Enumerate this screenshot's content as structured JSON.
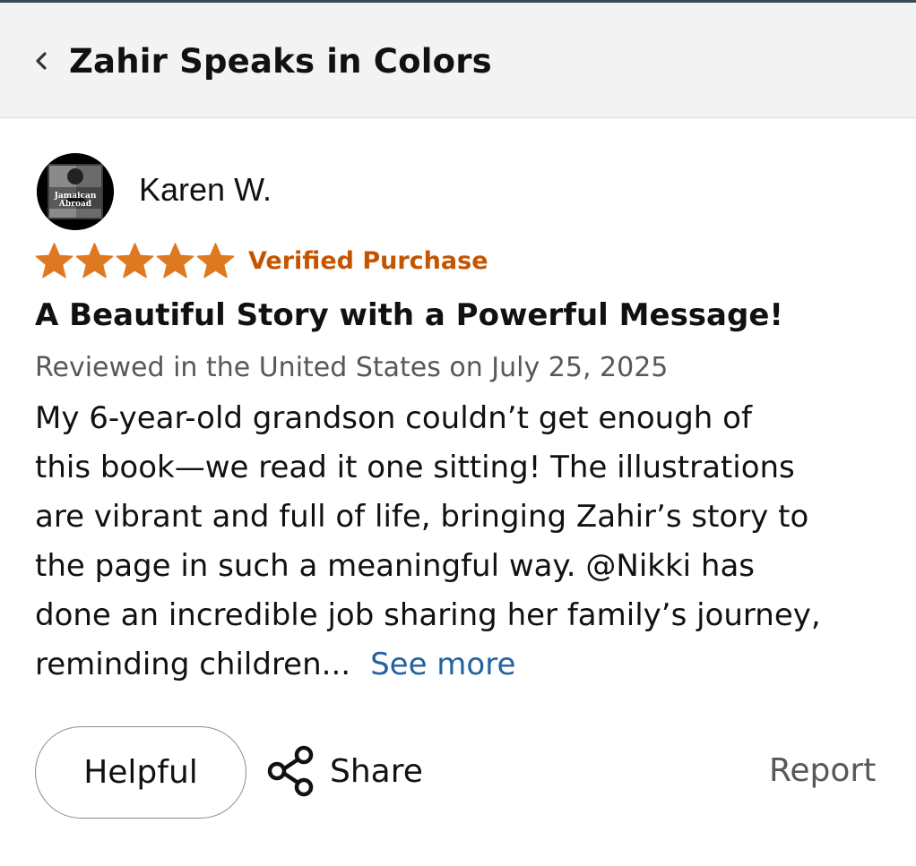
{
  "header": {
    "back_icon": "chevron-left-icon",
    "title": "Zahir Speaks in Colors"
  },
  "review": {
    "reviewer_name": "Karen W.",
    "avatar_text_1": "Jamaican",
    "avatar_text_2": "Abroad",
    "rating": 5,
    "rating_max": 5,
    "star_color": "#de7921",
    "verified_label": "Verified Purchase",
    "verified_color": "#c45500",
    "title": "A Beautiful Story with a Powerful Message!",
    "meta": "Reviewed in the United States on July 25, 2025",
    "body_lines": [
      "My 6-year-old grandson couldn’t get enough of",
      "this book—we read it one sitting! The illustrations",
      "are vibrant and full of life, bringing Zahir’s story to",
      "the page in such a meaningful way. @Nikki has",
      "done an incredible job sharing her family’s journey,",
      "reminding children..."
    ],
    "see_more_label": "See more",
    "link_color": "#2162a1"
  },
  "actions": {
    "helpful_label": "Helpful",
    "share_icon": "share-icon",
    "share_label": "Share",
    "report_label": "Report"
  }
}
